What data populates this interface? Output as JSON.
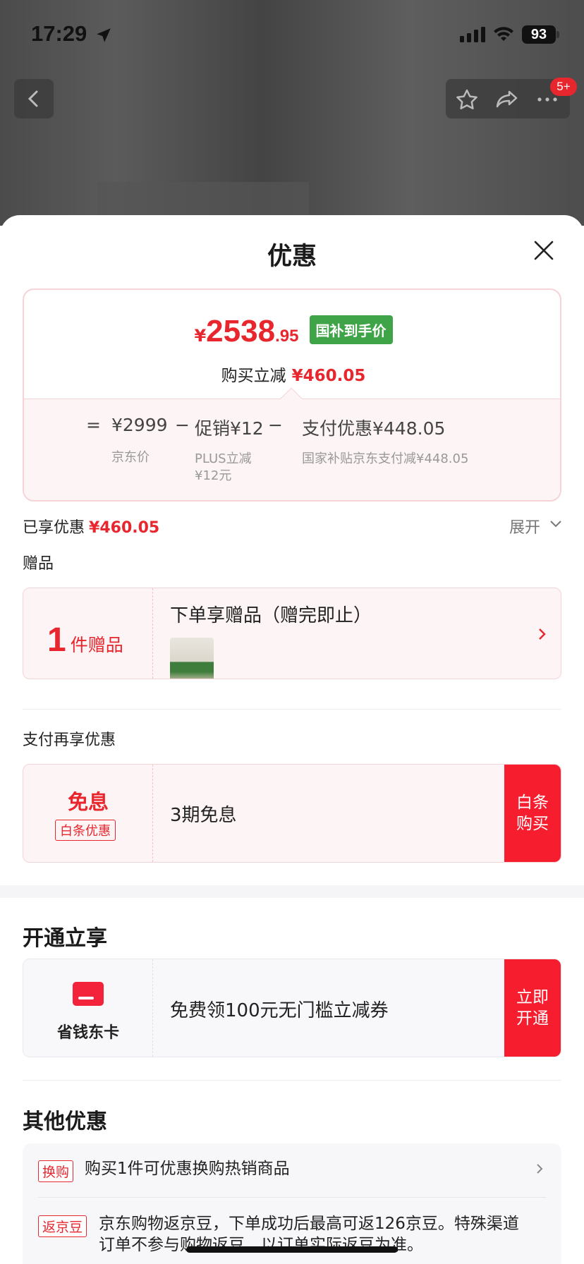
{
  "status_bar": {
    "time": "17:29",
    "battery": "93"
  },
  "nav": {
    "badge": "5+"
  },
  "sheet": {
    "title": "优惠",
    "price": {
      "currency": "¥",
      "integer": "2538",
      "decimal": ".95",
      "tag": "国补到手价",
      "reduce_label": "购买立减",
      "reduce_value": "¥460.05"
    },
    "formula": {
      "eq": "=",
      "jd_price": "¥2999",
      "jd_price_label": "京东价",
      "minus": "−",
      "promo": "促销¥12",
      "promo_sub1": "PLUS立减",
      "promo_sub2": "¥12元",
      "pay": "支付优惠¥448.05",
      "pay_sub": "国家补贴京东支付减¥448.05"
    },
    "enjoyed_label": "已享优惠",
    "enjoyed_value": "¥460.05",
    "expand_label": "展开",
    "gift_section": "赠品",
    "gift": {
      "count": "1",
      "unit": "件赠品",
      "title": "下单享赠品（赠完即止）"
    },
    "pay_section": "支付再享优惠",
    "installment": {
      "title": "免息",
      "tag": "白条优惠",
      "text": "3期免息",
      "button_line1": "白条",
      "button_line2": "购买"
    },
    "open_title": "开通立享",
    "card_offer": {
      "label": "省钱东卡",
      "text": "免费领100元无门槛立减券",
      "button_line1": "立即",
      "button_line2": "开通"
    },
    "other_title": "其他优惠",
    "other": [
      {
        "tag": "换购",
        "text": "购买1件可优惠换购热销商品"
      },
      {
        "tag": "返京豆",
        "text_line1": "京东购物返京豆，下单成功后最高可返126京豆。特殊渠道",
        "text_line2": "订单不参与购物返豆，以订单实际返豆为准。"
      }
    ]
  },
  "colors": {
    "accent": "#e8262e",
    "button": "#f61d2e",
    "green_tag": "#3fa447"
  }
}
